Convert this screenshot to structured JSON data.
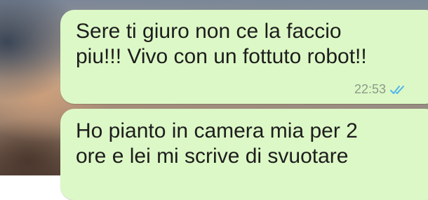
{
  "colors": {
    "bubble": "#dcf8c6",
    "text": "#1d1d1d",
    "timestamp": "#8d9a8a",
    "read_ticks": "#4fb6ec"
  },
  "messages": [
    {
      "text": "Sere ti giuro non ce la faccio\npiu!!! Vivo con un fottuto robot!!",
      "time": "22:53",
      "status_icon": "double-check-read-icon"
    },
    {
      "text": "Ho pianto in camera mia per 2\nore e lei mi scrive di svuotare"
    }
  ]
}
